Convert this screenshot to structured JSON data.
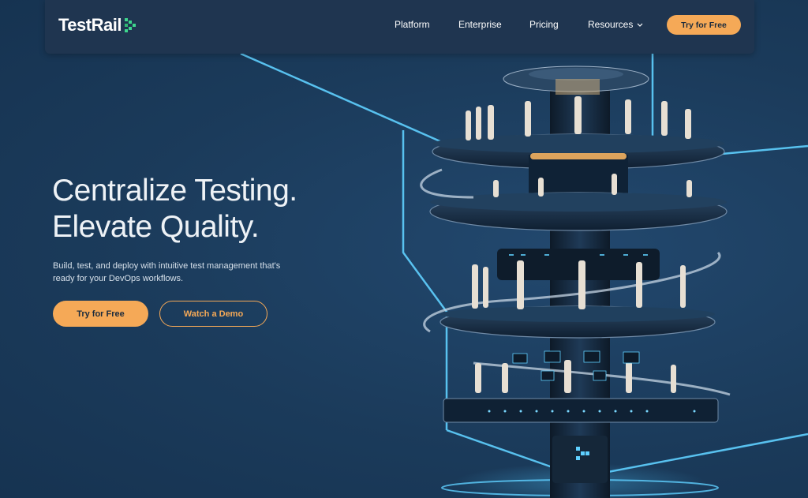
{
  "nav": {
    "logo_text": "TestRail",
    "links": [
      "Platform",
      "Enterprise",
      "Pricing",
      "Resources"
    ],
    "cta": "Try for Free"
  },
  "hero": {
    "title_line1": "Centralize Testing.",
    "title_line2": "Elevate Quality.",
    "subtitle": "Build, test, and deploy with intuitive test management that's ready for your DevOps workflows.",
    "primary_cta": "Try for Free",
    "secondary_cta": "Watch a Demo"
  },
  "colors": {
    "background": "#1c3d5f",
    "nav_background": "#1f3550",
    "accent": "#f5a957",
    "logo_mark": "#3dd68c",
    "neon": "#4fc8ff"
  },
  "icons": {
    "logo": "testrail-logo-icon",
    "dropdown": "chevron-down-icon"
  }
}
